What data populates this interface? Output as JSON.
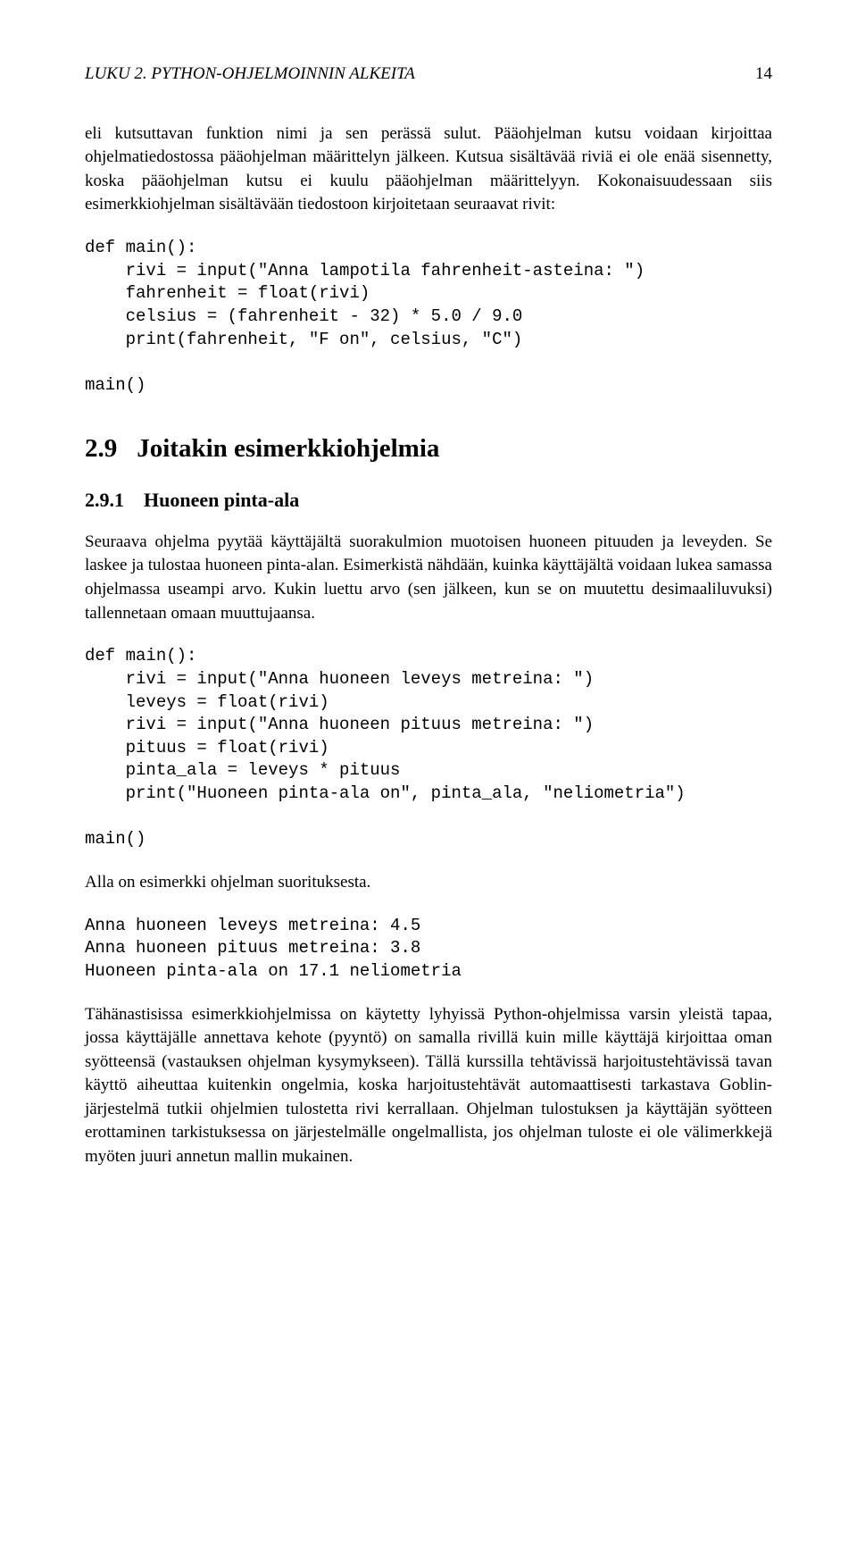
{
  "header": {
    "left": "LUKU 2. PYTHON-OHJELMOINNIN ALKEITA",
    "right": "14"
  },
  "para1": "eli kutsuttavan funktion nimi ja sen perässä sulut. Pääohjelman kutsu voidaan kirjoittaa ohjelmatiedostossa pääohjelman määrittelyn jälkeen. Kutsua sisältävää riviä ei ole enää sisennetty, koska pääohjelman kutsu ei kuulu pääohjelman määrittelyyn. Kokonaisuudessaan siis esimerkkiohjelman sisältävään tiedostoon kirjoitetaan seuraavat rivit:",
  "code1": "def main():\n    rivi = input(\"Anna lampotila fahrenheit-asteina: \")\n    fahrenheit = float(rivi)\n    celsius = (fahrenheit - 32) * 5.0 / 9.0\n    print(fahrenheit, \"F on\", celsius, \"C\")\n\nmain()",
  "section": {
    "num": "2.9",
    "title": "Joitakin esimerkkiohjelmia"
  },
  "subsection": {
    "num": "2.9.1",
    "title": "Huoneen pinta-ala"
  },
  "para2": "Seuraava ohjelma pyytää käyttäjältä suorakulmion muotoisen huoneen pituuden ja leveyden. Se laskee ja tulostaa huoneen pinta-alan. Esimerkistä nähdään, kuinka käyttäjältä voidaan lukea samassa ohjelmassa useampi arvo. Kukin luettu arvo (sen jälkeen, kun se on muutettu desimaaliluvuksi) tallennetaan omaan muuttujaansa.",
  "code2": "def main():\n    rivi = input(\"Anna huoneen leveys metreina: \")\n    leveys = float(rivi)\n    rivi = input(\"Anna huoneen pituus metreina: \")\n    pituus = float(rivi)\n    pinta_ala = leveys * pituus\n    print(\"Huoneen pinta-ala on\", pinta_ala, \"neliometria\")\n\nmain()",
  "para3": "Alla on esimerkki ohjelman suorituksesta.",
  "code3": "Anna huoneen leveys metreina: 4.5\nAnna huoneen pituus metreina: 3.8\nHuoneen pinta-ala on 17.1 neliometria",
  "para4": "Tähänastisissa esimerkkiohjelmissa on käytetty lyhyissä Python-ohjelmissa varsin yleistä tapaa, jossa käyttäjälle annettava kehote (pyyntö) on samalla rivillä kuin mille käyttäjä kirjoittaa oman syötteensä (vastauksen ohjelman kysymykseen). Tällä kurssilla tehtävissä harjoitustehtävissä tavan käyttö aiheuttaa kuitenkin ongelmia, koska harjoitustehtävät automaattisesti tarkastava Goblin-järjestelmä tutkii ohjelmien tulostetta rivi kerrallaan. Ohjelman tulostuksen ja käyttäjän syötteen erottaminen tarkistuksessa on järjestelmälle ongelmallista, jos ohjelman tuloste ei ole välimerkkejä myöten juuri annetun mallin mukainen."
}
